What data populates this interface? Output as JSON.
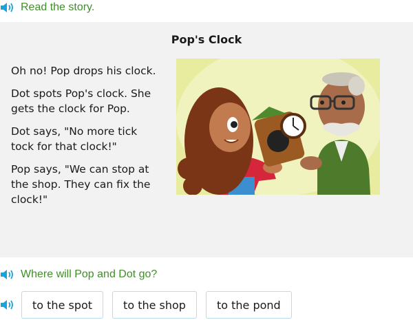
{
  "instruction": {
    "text": "Read the story.",
    "icon": "speaker-icon"
  },
  "story": {
    "title": "Pop's Clock",
    "paragraphs": [
      "Oh no! Pop drops his clock.",
      "Dot spots Pop's clock. She gets the clock for Pop.",
      "Dot says, \"No more tick tock for that clock!\"",
      "Pop says, \"We can stop at the shop. They can fix the clock!\""
    ]
  },
  "question": {
    "text": "Where will Pop and Dot go?",
    "icon": "speaker-icon"
  },
  "answers": {
    "icon": "speaker-icon",
    "choices": [
      "to the spot",
      "to the shop",
      "to the pond"
    ]
  },
  "colors": {
    "accent_green": "#3f8e28",
    "speaker_blue": "#1aa3d9",
    "panel_bg": "#f2f2f2",
    "choice_border": "#b8dce8"
  }
}
